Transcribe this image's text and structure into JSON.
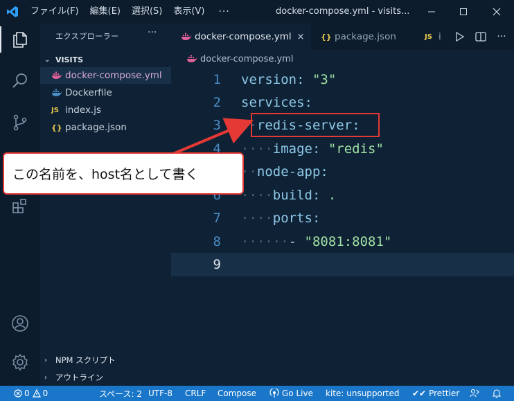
{
  "menu": [
    "ファイル(F)",
    "編集(E)",
    "選択(S)",
    "表示(V)"
  ],
  "menu_more": "···",
  "window_title": "docker-compose.yml - visits...",
  "sidebar": {
    "title": "エクスプローラー",
    "more": "···",
    "folder": "VISITS",
    "files": [
      {
        "name": "docker-compose.yml",
        "icon": "docker-whale-icon"
      },
      {
        "name": "Dockerfile",
        "icon": "docker-whale-icon"
      },
      {
        "name": "index.js",
        "icon": "js-icon",
        "badge": "JS"
      },
      {
        "name": "package.json",
        "icon": "json-icon",
        "badge": "{}"
      }
    ],
    "sections": [
      "NPM スクリプト",
      "アウトライン"
    ]
  },
  "tabs": [
    {
      "label": "docker-compose.yml",
      "close": "×",
      "active": true
    },
    {
      "label": "package.json",
      "badge": "{}",
      "active": false
    },
    {
      "label": "i",
      "badge": "JS",
      "active": false
    }
  ],
  "breadcrumb": "docker-compose.yml",
  "editor": {
    "lines": [
      {
        "n": "1"
      },
      {
        "n": "2"
      },
      {
        "n": "3"
      },
      {
        "n": "4"
      },
      {
        "n": "5"
      },
      {
        "n": "6"
      },
      {
        "n": "7"
      },
      {
        "n": "8"
      },
      {
        "n": "9"
      }
    ],
    "tokens": {
      "version_key": "version:",
      "version_val": "\"3\"",
      "services_key": "services:",
      "redis_key": "redis-server:",
      "image_key": "image:",
      "image_val": "\"redis\"",
      "node_key": "node-app:",
      "build_key": "build:",
      "build_val": ".",
      "ports_key": "ports:",
      "port_dash": "-",
      "port_val": "\"8081:8081\""
    }
  },
  "annotation": {
    "callout_text": "この名前を、host名として書く",
    "color": "#e53935"
  },
  "statusbar": {
    "errors": "0",
    "warnings": "0",
    "spaces": "スペース: 2",
    "encoding": "UTF-8",
    "eol": "CRLF",
    "language": "Compose",
    "golive": "Go Live",
    "kite": "kite: unsupported",
    "prettier": "Prettier",
    "background": "#1976c8"
  },
  "colors": {
    "background": "#0f2235",
    "key": "#8dc8e8",
    "string": "#9fe0a3",
    "line_number": "#4a8cc4"
  }
}
